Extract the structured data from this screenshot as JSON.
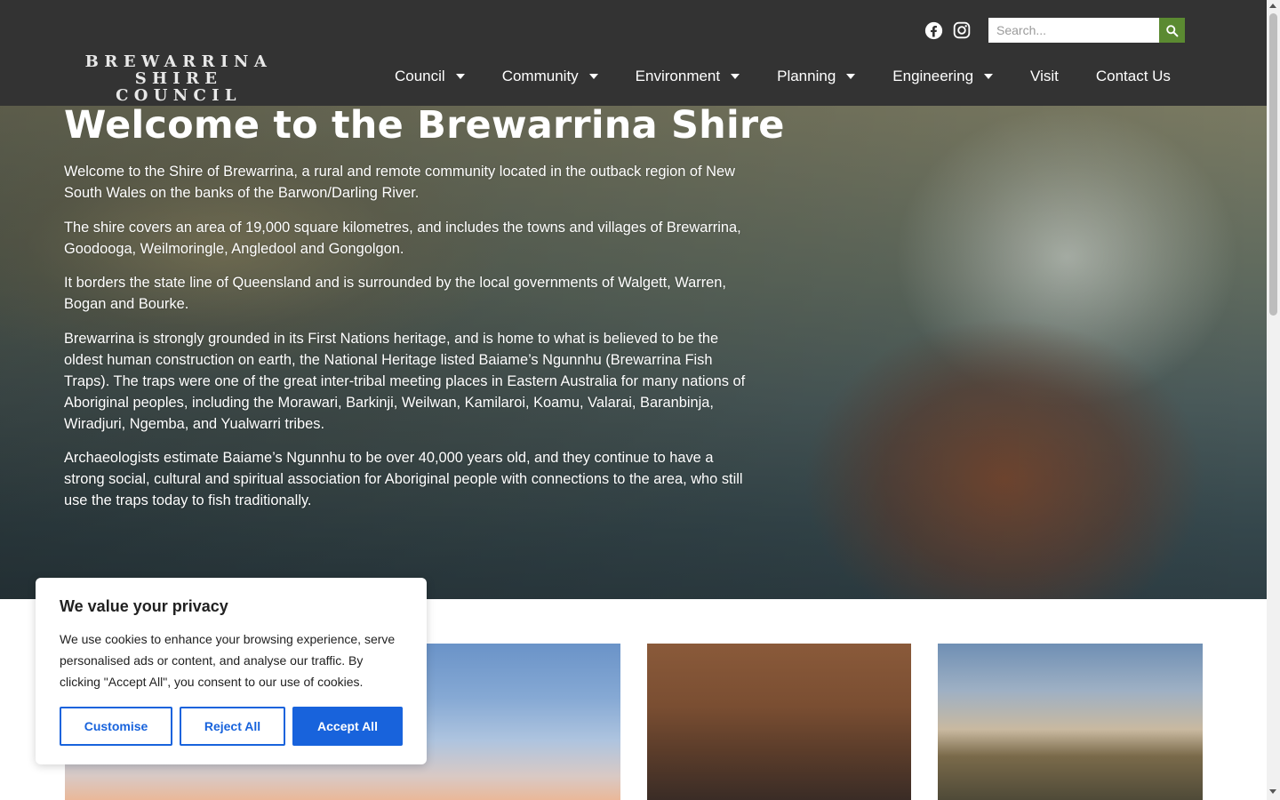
{
  "header": {
    "logo_line1": "BREWARRINA",
    "logo_line2": "SHIRE COUNCIL",
    "social": [
      {
        "name": "facebook-icon"
      },
      {
        "name": "instagram-icon"
      }
    ],
    "search": {
      "placeholder": "Search...",
      "value": ""
    },
    "nav": [
      {
        "label": "Council",
        "has_dropdown": true
      },
      {
        "label": "Community",
        "has_dropdown": true
      },
      {
        "label": "Environment",
        "has_dropdown": true
      },
      {
        "label": "Planning",
        "has_dropdown": true
      },
      {
        "label": "Engineering",
        "has_dropdown": true
      },
      {
        "label": "Visit",
        "has_dropdown": false
      },
      {
        "label": "Contact Us",
        "has_dropdown": false
      }
    ]
  },
  "hero": {
    "title": "Welcome to the Brewarrina Shire",
    "paragraphs": [
      "Welcome to the Shire of Brewarrina, a rural and remote community located in the outback region of New South Wales on the banks of the Barwon/Darling River.",
      "The shire covers an area of 19,000 square kilometres, and includes the towns and villages of Brewarrina, Goodooga, Weilmoringle, Angledool and Gongolgon.",
      "It borders the state line of Queensland and is surrounded by the local governments of Walgett, Warren, Bogan and Bourke.",
      "Brewarrina is strongly grounded in its First Nations heritage, and is home to what is believed to be the oldest human construction on earth, the National Heritage listed Baiame’s Ngunnhu (Brewarrina Fish Traps). The traps were one of the great inter-tribal meeting places in Eastern Australia for many nations of Aboriginal peoples, including the Morawari, Barkinji, Weilwan, Kamilaroi, Koamu, Valarai, Baranbinja, Wiradjuri, Ngemba, and Yualwarri tribes.",
      "Archaeologists estimate Baiame’s Ngunnhu to be over 40,000 years old, and they continue to have a strong social, cultural and spiritual association for Aboriginal people with connections to the area, who still use the traps today to fish traditionally."
    ]
  },
  "cookie": {
    "title": "We value your privacy",
    "text": "We use cookies to enhance your browsing experience, serve personalised ads or content, and analyse our traffic. By clicking \"Accept All\", you consent to our use of cookies.",
    "customise_label": "Customise",
    "reject_label": "Reject All",
    "accept_label": "Accept All"
  },
  "colors": {
    "header_bg": "#333333",
    "search_button": "#5b8a31",
    "cookie_accent": "#1863dc"
  }
}
